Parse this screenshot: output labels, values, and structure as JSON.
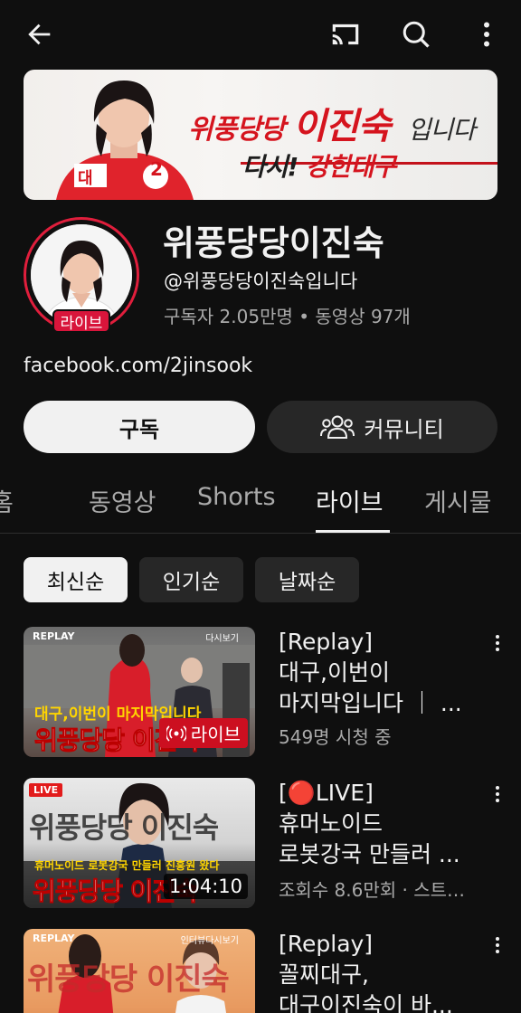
{
  "topbar": {
    "back_icon": "arrow-left-icon",
    "cast_icon": "cast-icon",
    "search_icon": "search-icon",
    "more_icon": "more-vertical-icon"
  },
  "banner": {
    "line1_a": "위풍당당",
    "line1_b": "이진숙",
    "line1_c": "입니다",
    "line2_a": "다시!",
    "line2_b": "강한대구",
    "jacket_number": "2",
    "jacket_text": "대"
  },
  "channel": {
    "name": "위풍당당이진숙",
    "handle": "@위풍당당이진숙입니다",
    "stats": "구독자 2.05만명 • 동영상 97개",
    "live_badge": "라이브",
    "link": "facebook.com/2jinsook"
  },
  "actions": {
    "subscribe": "구독",
    "community": "커뮤니티",
    "community_icon": "people-icon"
  },
  "tabs": [
    {
      "label": "홈"
    },
    {
      "label": "동영상"
    },
    {
      "label": "Shorts"
    },
    {
      "label": "라이브",
      "active": true
    },
    {
      "label": "게시물"
    }
  ],
  "chips": [
    {
      "label": "최신순",
      "selected": true
    },
    {
      "label": "인기순"
    },
    {
      "label": "날짜순"
    }
  ],
  "videos": [
    {
      "title_line1": "[Replay]",
      "title_line2": "대구,이번이",
      "title_line3": "마지막입니다 ｜ ...",
      "meta": "549명 시청 중",
      "thumb_tag": "REPLAY",
      "thumb_corner": "다시보기",
      "thumb_caption": "대구,이번이 마지막입니다",
      "thumb_big": "위풍당당 이진숙",
      "badge": "라이브"
    },
    {
      "title_line1": "[🔴LIVE]",
      "title_line2": "휴머노이드",
      "title_line3": "로봇강국 만들러 ...",
      "meta": "조회수 8.6만회 · 스트리...",
      "thumb_tag": "LIVE",
      "thumb_top": "위풍당당 이진숙",
      "thumb_caption": "휴머노이드 로봇강국 만들러 진흥원 왔다",
      "thumb_big": "위풍당당 이진숙",
      "duration": "1:04:10"
    },
    {
      "title_line1": "[Replay]",
      "title_line2": "꼴찌대구,",
      "title_line3": "대구이진숙이 바...",
      "thumb_tag": "REPLAY",
      "thumb_corner": "인터뷰다시보기",
      "thumb_top": "위풍당당 이진숙"
    }
  ]
}
